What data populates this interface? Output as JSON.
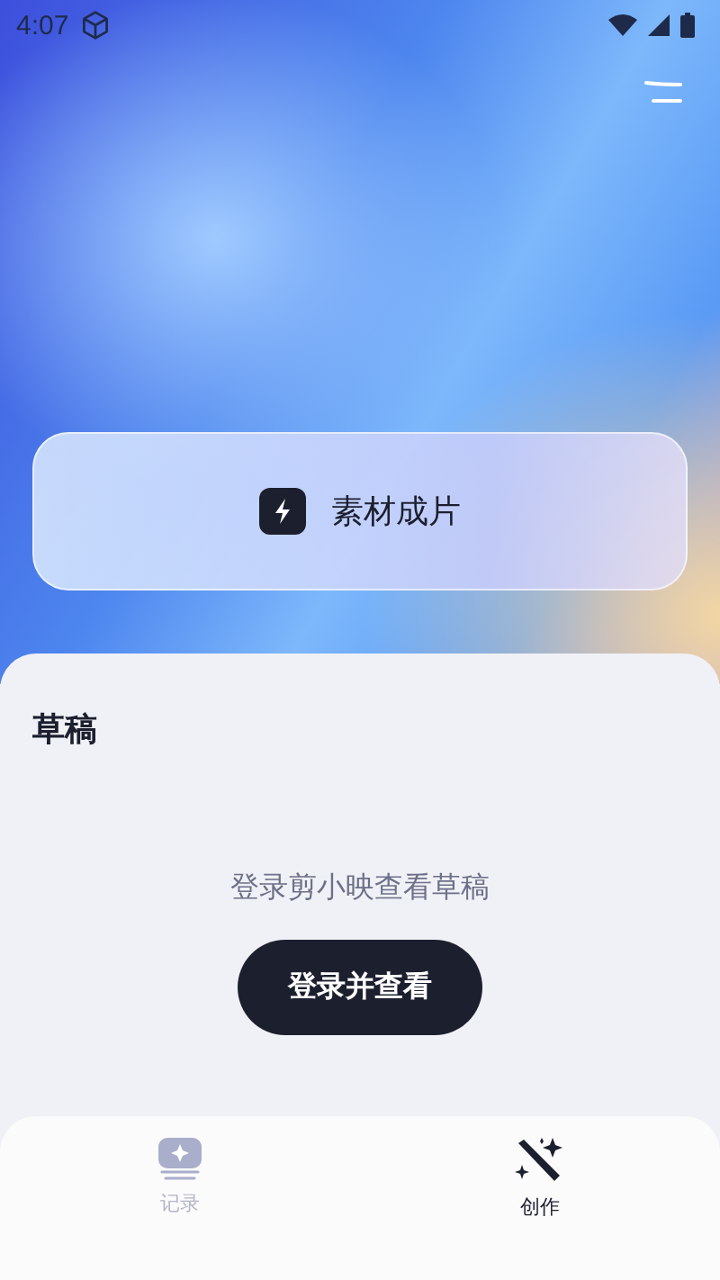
{
  "status_bar": {
    "time": "4:07"
  },
  "feature_card": {
    "label": "素材成片"
  },
  "drafts": {
    "title": "草稿",
    "message": "登录剪小映查看草稿",
    "button": "登录并查看"
  },
  "bottom_nav": [
    {
      "label": "记录",
      "selected": false,
      "kind": "record"
    },
    {
      "label": "创作",
      "selected": true,
      "kind": "create"
    }
  ]
}
